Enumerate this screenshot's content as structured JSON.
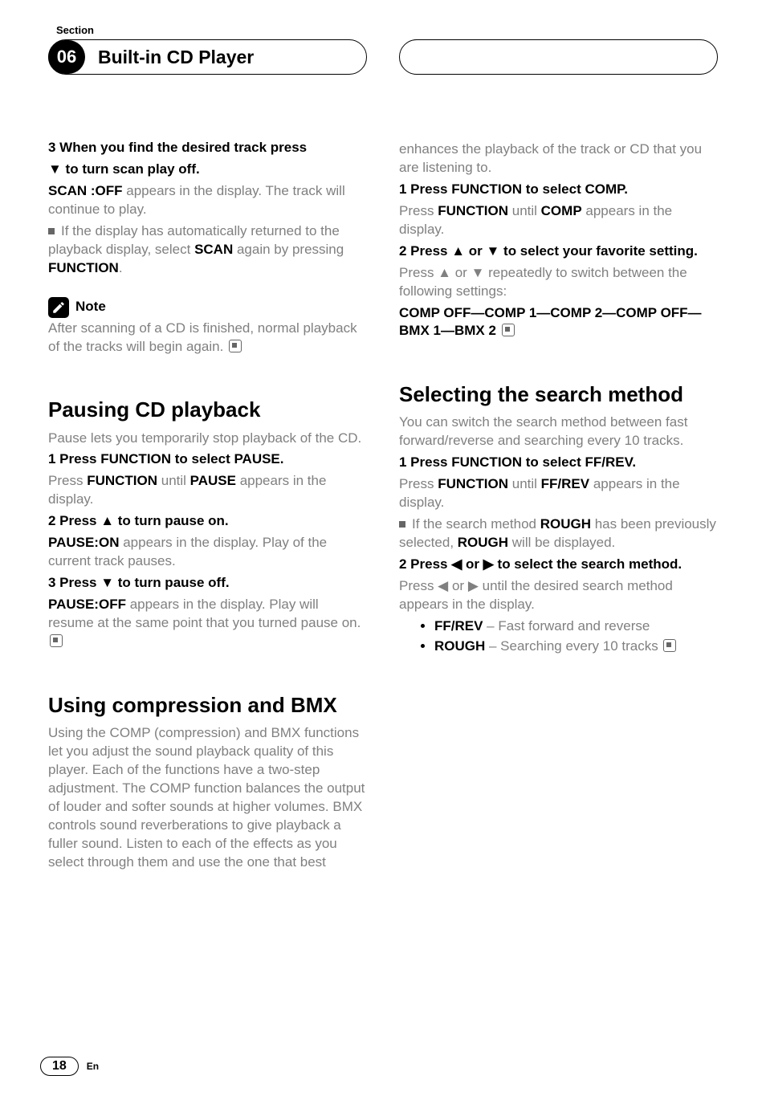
{
  "header": {
    "section_label": "Section",
    "section_number": "06",
    "section_title": "Built-in CD Player"
  },
  "left_col": {
    "s3_head_a": "3    When you find the desired track press",
    "s3_head_b": "▼ to turn scan play off.",
    "s3_p1_a": "SCAN :OFF",
    "s3_p1_b": " appears in the display. The track will continue to play.",
    "s3_bullet_a": "If the display has automatically returned to the playback display, select ",
    "s3_bullet_b": "SCAN",
    "s3_bullet_c": " again by pressing ",
    "s3_bullet_d": "FUNCTION",
    "s3_bullet_e": ".",
    "note_label": "Note",
    "note_text": "After scanning of a CD is finished, normal playback of the tracks will begin again.",
    "pause_h": "Pausing CD playback",
    "pause_intro": "Pause lets you temporarily stop playback of the CD.",
    "pause1_head": "1    Press FUNCTION to select PAUSE.",
    "pause1_a": "Press ",
    "pause1_b": "FUNCTION",
    "pause1_c": " until ",
    "pause1_d": "PAUSE",
    "pause1_e": " appears in the display.",
    "pause2_head": "2    Press ▲ to turn pause on.",
    "pause2_a": "PAUSE:ON",
    "pause2_b": " appears in the display. Play of the current track pauses.",
    "pause3_head": "3    Press ▼ to turn pause off.",
    "pause3_a": "PAUSE:OFF",
    "pause3_b": " appears in the display. Play will resume at the same point that you turned pause on.",
    "comp_h": "Using compression and BMX",
    "comp_intro": "Using the COMP (compression) and BMX functions let you adjust the sound playback quality of this player. Each of the functions have a two-step adjustment. The COMP function balances the output of louder and softer sounds at higher volumes. BMX controls sound reverberations to give playback a fuller sound. Listen to each of the effects as you select through them and use the one that best"
  },
  "right_col": {
    "comp_cont": "enhances the playback of the track or CD that you are listening to.",
    "c1_head": "1    Press FUNCTION to select COMP.",
    "c1_a": "Press ",
    "c1_b": "FUNCTION",
    "c1_c": " until ",
    "c1_d": "COMP",
    "c1_e": " appears in the display.",
    "c2_head": "2    Press ▲ or ▼ to select your favorite setting.",
    "c2_a": "Press ▲ or ▼ repeatedly to switch between the following settings:",
    "c2_seq": "COMP OFF—COMP 1—COMP 2—COMP OFF—BMX 1—BMX 2",
    "search_h": "Selecting the search method",
    "search_intro": "You can switch the search method between fast forward/reverse and searching every 10 tracks.",
    "sr1_head": "1    Press FUNCTION to select FF/REV.",
    "sr1_a": "Press ",
    "sr1_b": "FUNCTION",
    "sr1_c": " until ",
    "sr1_d": "FF/REV",
    "sr1_e": " appears in the display.",
    "sr1_bullet_a": "If the search method ",
    "sr1_bullet_b": "ROUGH",
    "sr1_bullet_c": " has been previously selected, ",
    "sr1_bullet_d": "ROUGH",
    "sr1_bullet_e": " will be displayed.",
    "sr2_head": "2    Press ◀ or ▶ to select the search method.",
    "sr2_a": "Press ◀ or ▶ until the desired search method appears in the display.",
    "method1_a": "FF/REV",
    "method1_b": " – Fast forward and reverse",
    "method2_a": "ROUGH",
    "method2_b": " – Searching every 10 tracks"
  },
  "footer": {
    "page": "18",
    "lang": "En"
  }
}
